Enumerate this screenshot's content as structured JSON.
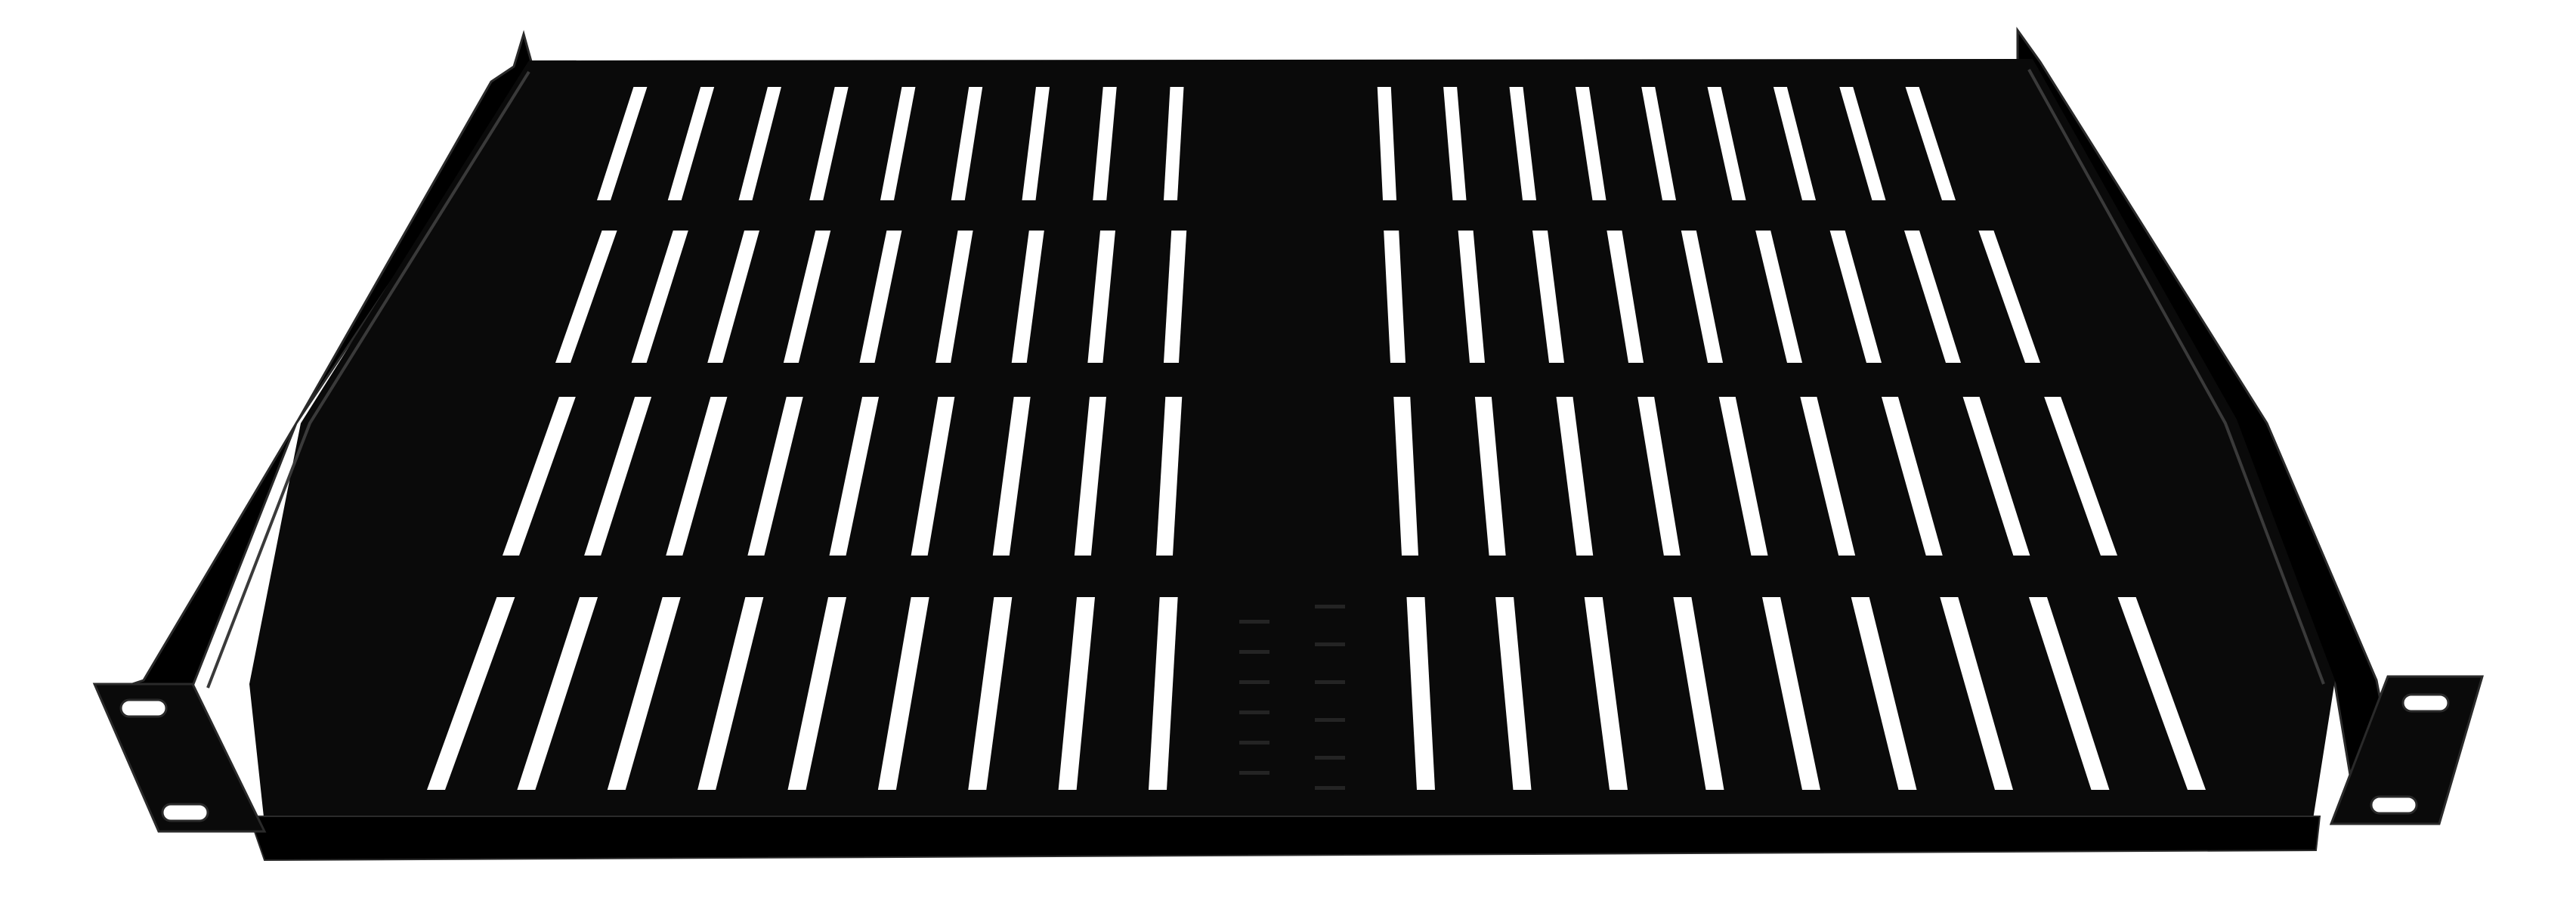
{
  "scene": {
    "subject": "rack-mount-cantilever-shelf",
    "colors": {
      "background": "#FFFFFF",
      "metal_face": "#0A0A0A",
      "metal_shadow": "#000000",
      "metal_highlight": "#3A3A3A",
      "metal_edge": "#2A2A2A",
      "vent_slot": "#FFFFFF"
    },
    "vent_grid": {
      "left_columns": 9,
      "right_columns": 9,
      "rows": 4
    },
    "mounting_holes_per_ear": 2
  }
}
